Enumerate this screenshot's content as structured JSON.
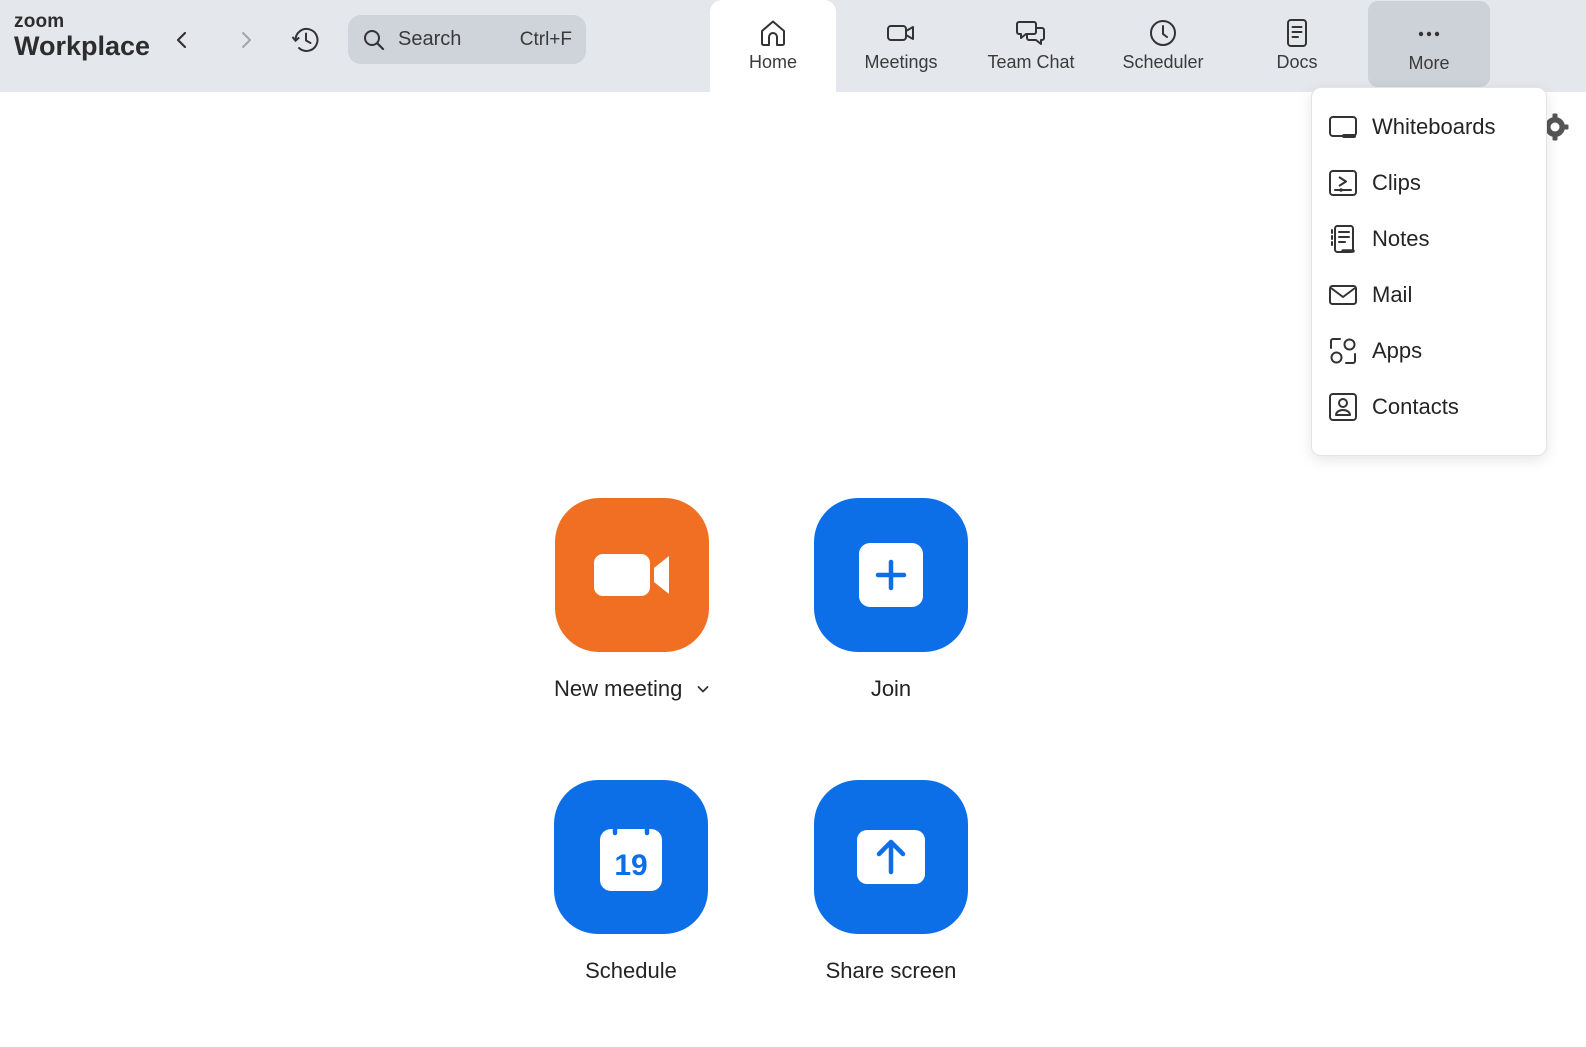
{
  "app": {
    "logo_zoom": "zoom",
    "logo_workplace": "Workplace"
  },
  "search": {
    "label": "Search",
    "shortcut": "Ctrl+F"
  },
  "tabs": {
    "home": "Home",
    "meetings": "Meetings",
    "team_chat": "Team Chat",
    "scheduler": "Scheduler",
    "docs": "Docs",
    "more": "More"
  },
  "more_menu": {
    "whiteboards": "Whiteboards",
    "clips": "Clips",
    "notes": "Notes",
    "mail": "Mail",
    "apps": "Apps",
    "contacts": "Contacts"
  },
  "actions": {
    "new_meeting": "New meeting",
    "join": "Join",
    "schedule": "Schedule",
    "share_screen": "Share screen"
  },
  "calendar_day": "19",
  "icons": {
    "back": "chevron-left-icon",
    "forward": "chevron-right-icon",
    "history": "history-clock-icon",
    "search": "search-icon",
    "home": "home-icon",
    "meetings": "video-camera-icon",
    "team_chat": "chat-bubbles-icon",
    "scheduler": "clock-icon",
    "docs": "document-icon",
    "more": "ellipsis-icon",
    "settings": "gear-icon"
  },
  "colors": {
    "topbar": "#e4e7ec",
    "new_meeting_tile": "#f06f22",
    "action_tile": "#0d6fe8"
  }
}
